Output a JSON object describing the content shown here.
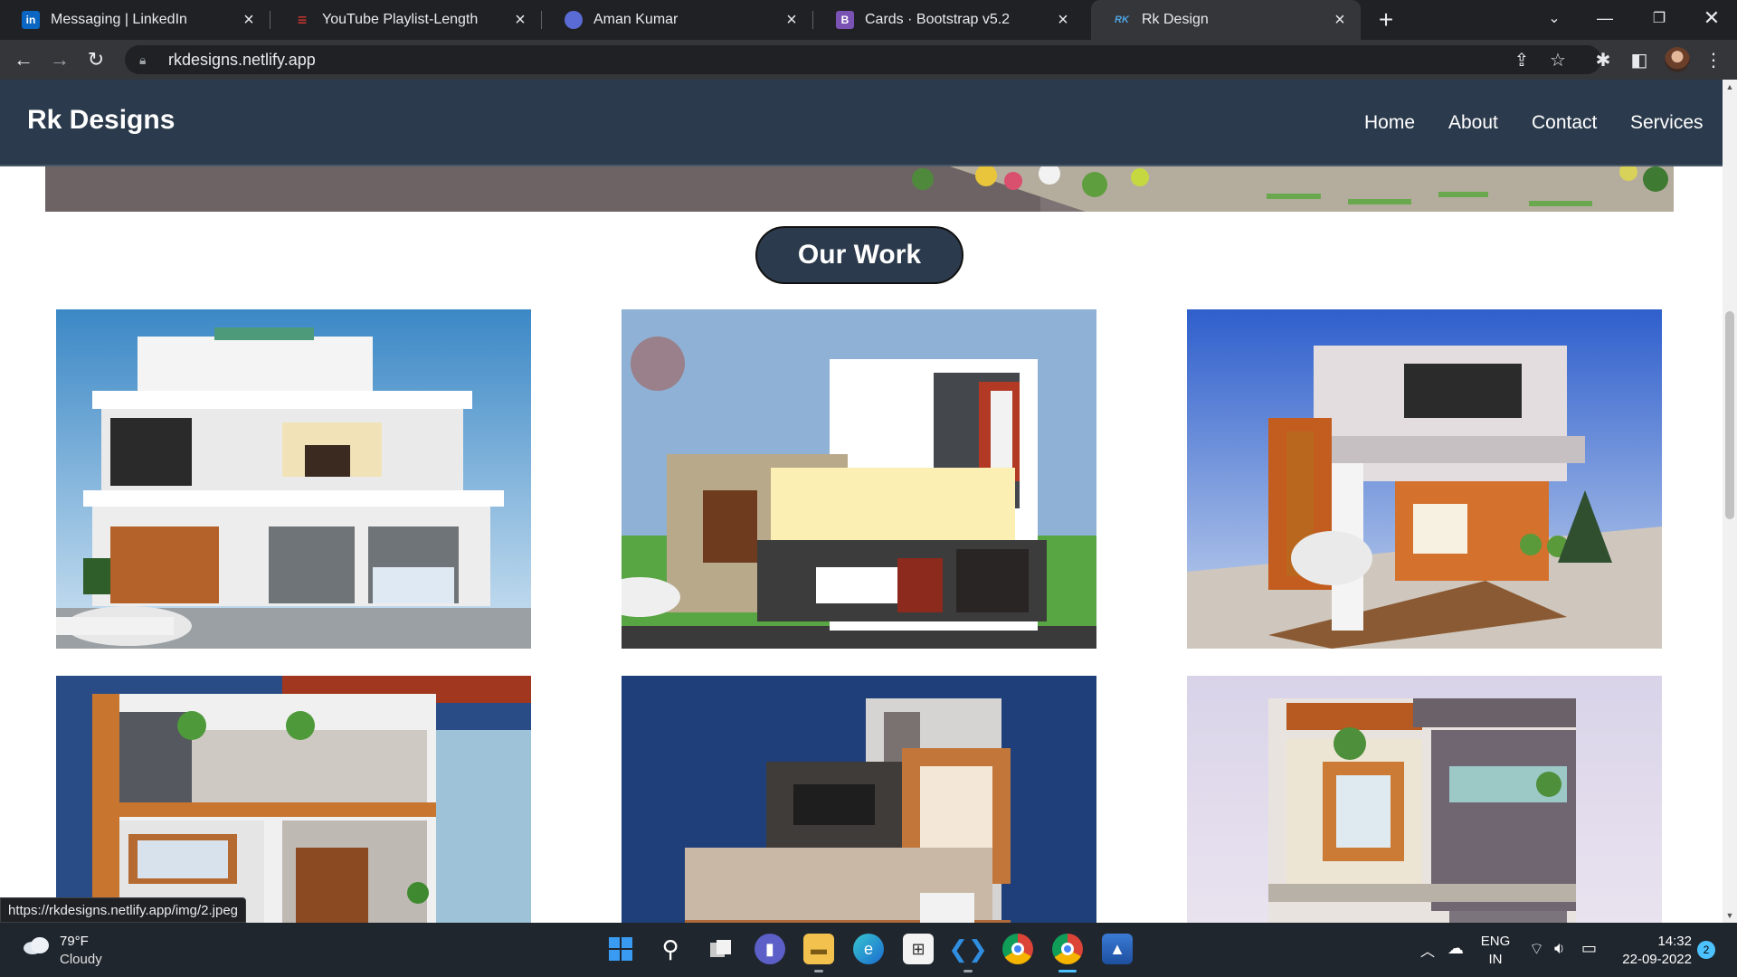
{
  "browser": {
    "tabs": [
      {
        "title": "Messaging | LinkedIn",
        "icon": "linkedin-icon",
        "favicon_text": "in",
        "color": "#0a66c2"
      },
      {
        "title": "YouTube Playlist-Length",
        "icon": "playlist-icon",
        "favicon_text": "≡",
        "color": "#e53935"
      },
      {
        "title": "Aman Kumar",
        "icon": "profile-icon",
        "favicon_text": "",
        "color": "#5b6bd5"
      },
      {
        "title": "Cards · Bootstrap v5.2",
        "icon": "bootstrap-icon",
        "favicon_text": "B",
        "color": "#7952b3"
      },
      {
        "title": "Rk Design",
        "icon": "rk-design-icon",
        "favicon_text": "RK",
        "color": "#4fa3e0"
      }
    ],
    "active_tab": 4,
    "url": "rkdesigns.netlify.app",
    "status_url": "https://rkdesigns.netlify.app/img/2.jpeg"
  },
  "site": {
    "brand": "Rk Designs",
    "nav": [
      "Home",
      "About",
      "Contact",
      "Services"
    ],
    "section_title": "Our Work",
    "colors": {
      "navbar": "#2b3a4c",
      "pill": "#2b3a4c"
    },
    "gallery": [
      {
        "alt": "house-render-1"
      },
      {
        "alt": "house-render-2"
      },
      {
        "alt": "house-render-3"
      },
      {
        "alt": "house-render-4"
      },
      {
        "alt": "house-render-5"
      },
      {
        "alt": "house-render-6"
      }
    ]
  },
  "taskbar": {
    "weather_temp": "79°F",
    "weather_desc": "Cloudy",
    "lang_line1": "ENG",
    "lang_line2": "IN",
    "time": "14:32",
    "date": "22-09-2022",
    "notification_count": "2"
  }
}
